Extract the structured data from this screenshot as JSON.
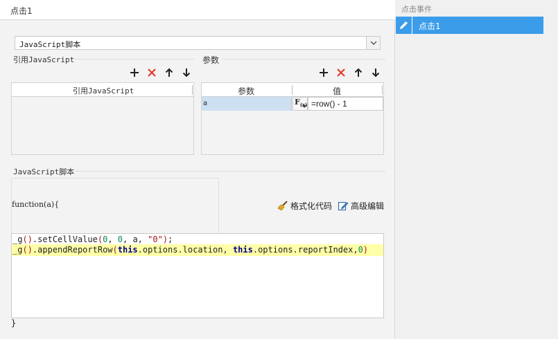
{
  "left_panel": {
    "title": "点击1",
    "script_type": "JavaScript脚本",
    "ref_js": {
      "label": "引用JavaScript",
      "column_header": "引用JavaScript"
    },
    "params": {
      "label": "参数",
      "columns": [
        "参数",
        "值"
      ],
      "rows": [
        {
          "name": "a",
          "value": "=row() - 1",
          "formula_button": "F(x)"
        }
      ]
    },
    "script": {
      "label": "JavaScript脚本",
      "function_header": "function(a){",
      "format_code": "格式化代码",
      "advanced_edit": "高级编辑",
      "code_lines": [
        "_g().setCellValue(0, 0, a, \"0\");",
        "_g().appendReportRow(this.options.location, this.options.reportIndex,0)"
      ],
      "highlighted_line": 2,
      "function_footer": "}"
    },
    "icons": {
      "add": "plus-icon",
      "delete": "delete-x-icon",
      "up": "arrow-up-icon",
      "down": "arrow-down-icon",
      "format": "broom-icon",
      "edit": "edit-icon"
    },
    "colors": {
      "delete_red": "#e23b2e",
      "selected_param_bg": "#cde0f1",
      "highlight_line": "#ffffa8"
    }
  },
  "right_panel": {
    "title": "点击事件",
    "events": [
      {
        "label": "点击1",
        "icon": "pencil-icon",
        "selected": true
      }
    ],
    "colors": {
      "selected_bg": "#3b9cea"
    }
  }
}
